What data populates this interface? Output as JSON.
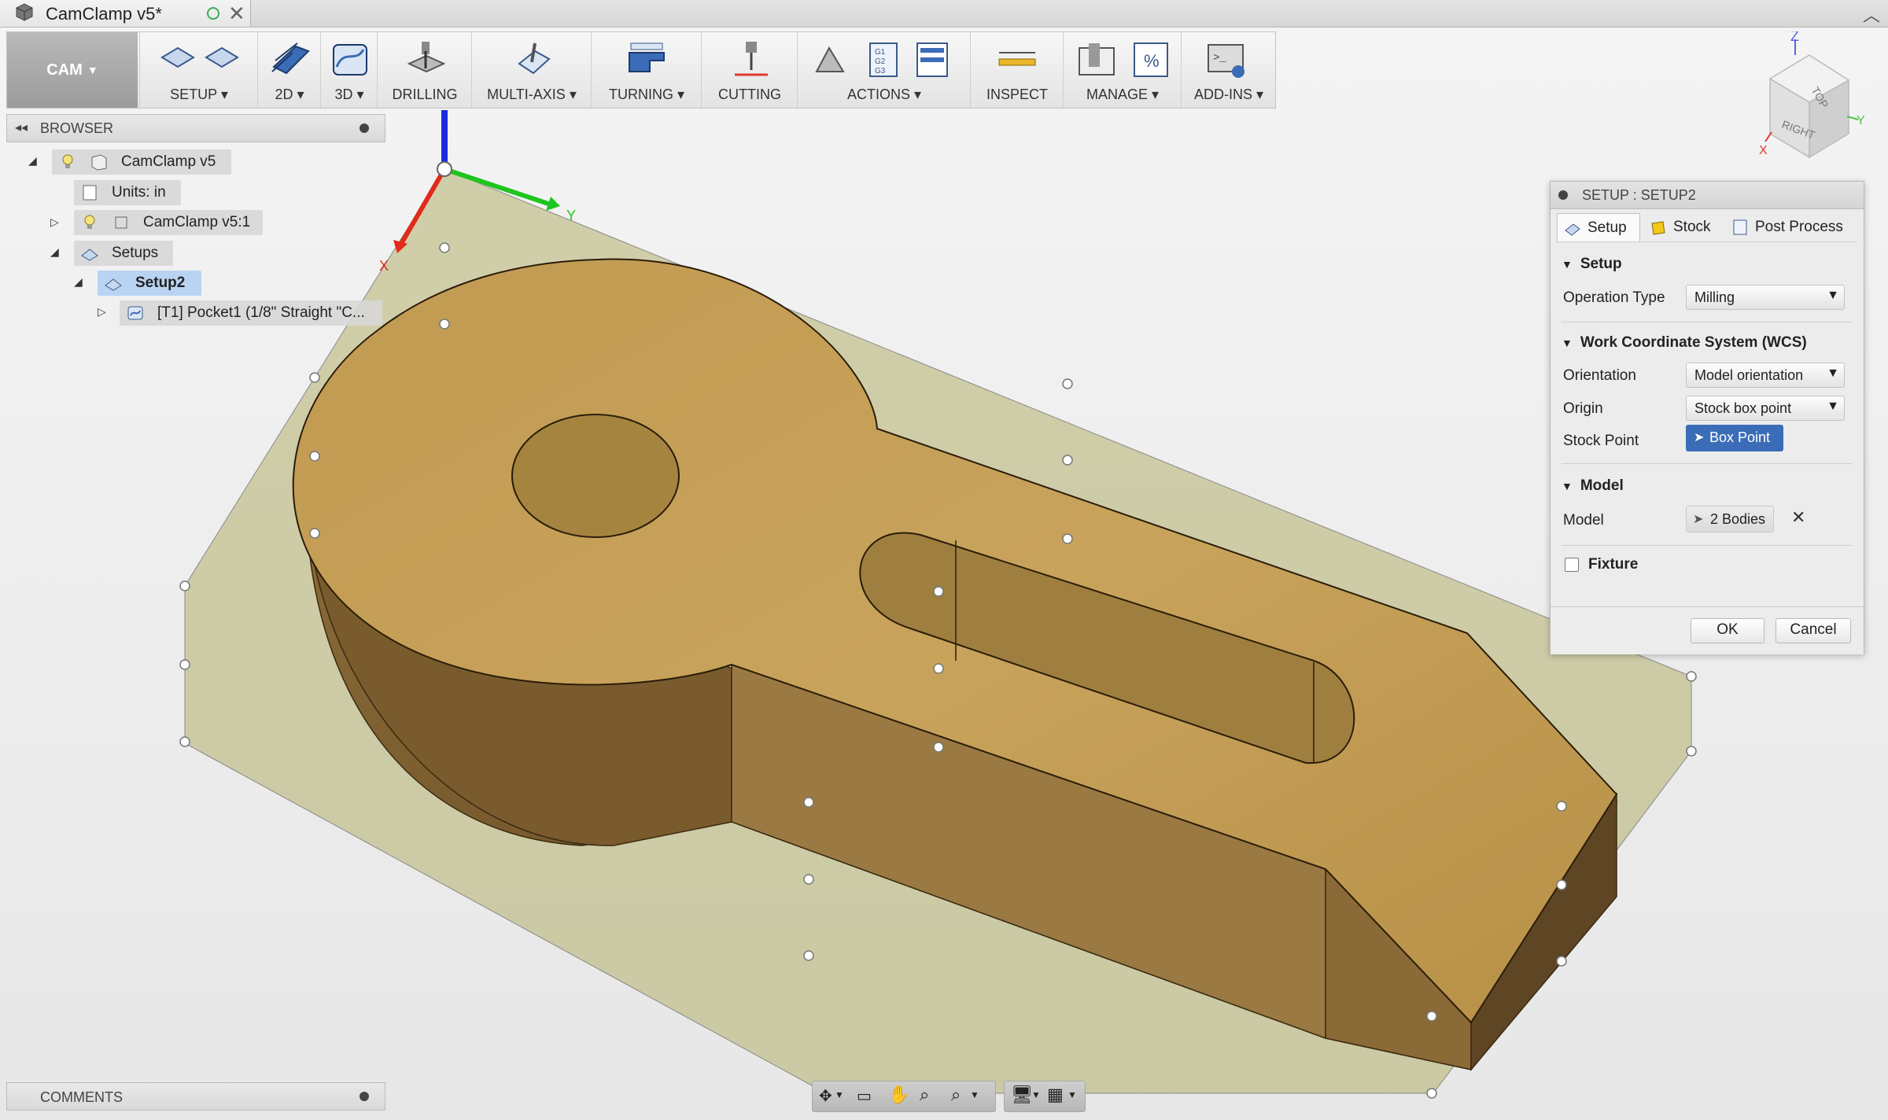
{
  "app": {
    "document_title": "CamClamp v5*"
  },
  "toolbar": {
    "workspace_label": "CAM",
    "groups": [
      {
        "label": "SETUP"
      },
      {
        "label": "2D"
      },
      {
        "label": "3D"
      },
      {
        "label": "DRILLING"
      },
      {
        "label": "MULTI-AXIS"
      },
      {
        "label": "TURNING"
      },
      {
        "label": "CUTTING"
      },
      {
        "label": "ACTIONS"
      },
      {
        "label": "INSPECT"
      },
      {
        "label": "MANAGE"
      },
      {
        "label": "ADD-INS"
      }
    ]
  },
  "browser": {
    "title": "BROWSER",
    "items": [
      {
        "label": "CamClamp v5"
      },
      {
        "label": "Units: in"
      },
      {
        "label": "CamClamp v5:1"
      },
      {
        "label": "Setups"
      },
      {
        "label": "Setup2"
      },
      {
        "label": "[T1] Pocket1 (1/8\" Straight \"C..."
      }
    ]
  },
  "comments": {
    "title": "COMMENTS"
  },
  "viewcube": {
    "top": "TOP",
    "right": "RIGHT",
    "axis_z": "Z",
    "axis_y": "Y",
    "axis_x": "X"
  },
  "gizmo": {
    "y": "Y",
    "x": "X"
  },
  "dialog": {
    "title": "SETUP : SETUP2",
    "tabs": [
      {
        "label": "Setup"
      },
      {
        "label": "Stock"
      },
      {
        "label": "Post Process"
      }
    ],
    "sections": {
      "setup": "Setup",
      "wcs": "Work Coordinate System (WCS)",
      "model": "Model",
      "fixture": "Fixture"
    },
    "operation_type": {
      "label": "Operation Type",
      "value": "Milling"
    },
    "orientation": {
      "label": "Orientation",
      "value": "Model orientation"
    },
    "origin": {
      "label": "Origin",
      "value": "Stock box point"
    },
    "stock_point": {
      "label": "Stock Point",
      "button": "Box Point"
    },
    "model_row": {
      "label": "Model",
      "value": "2 Bodies"
    },
    "fixture_checked": false,
    "ok": "OK",
    "cancel": "Cancel"
  },
  "colors": {
    "accent": "#3b6cb7",
    "selected_node": "#b9d4f2",
    "part": "#b8954a"
  }
}
